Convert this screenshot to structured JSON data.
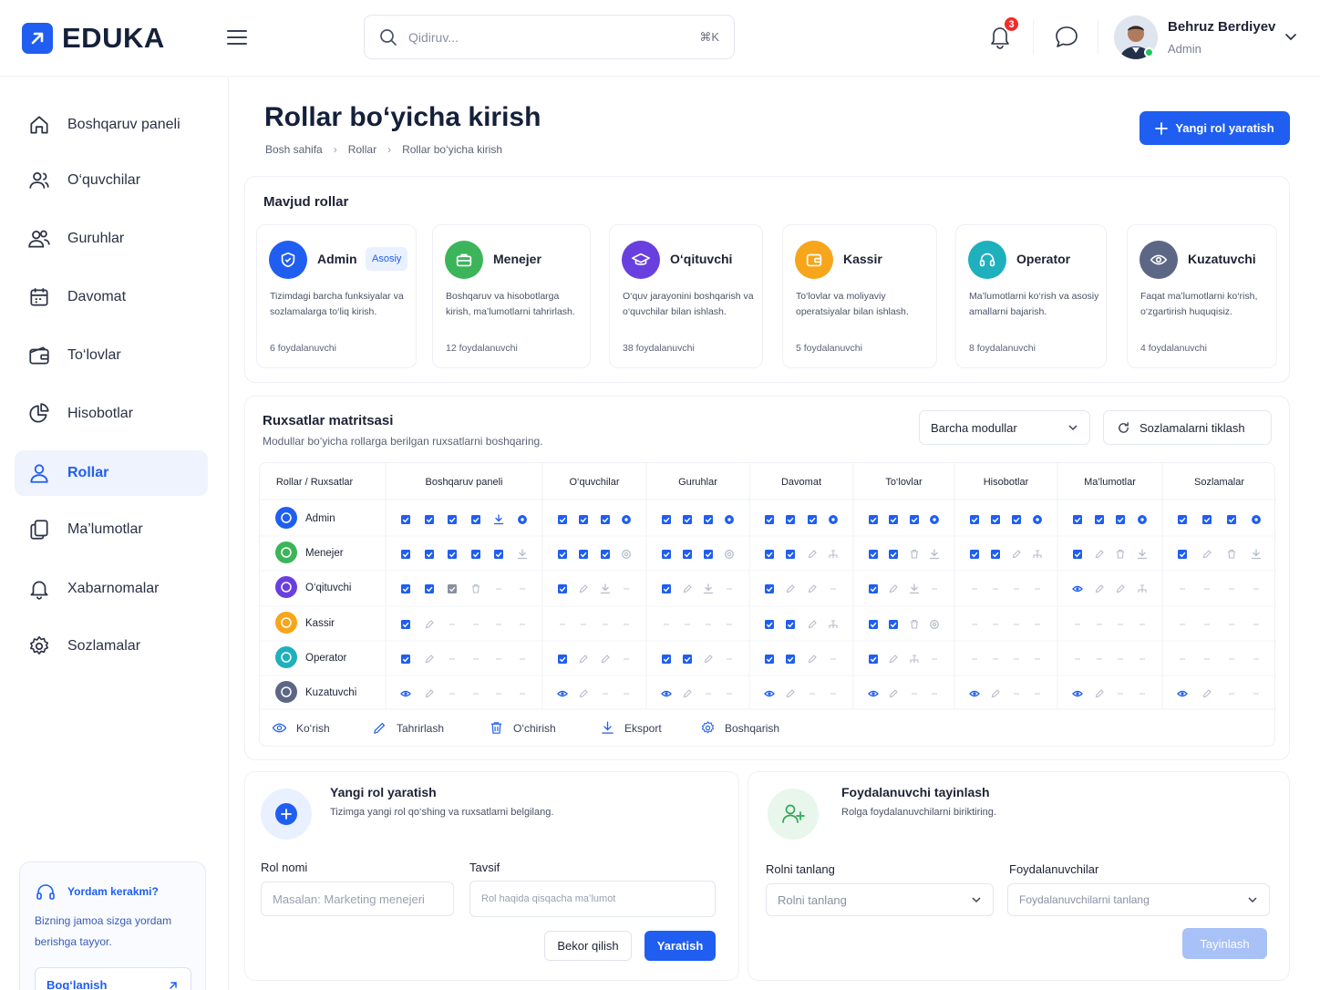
{
  "brand": {
    "name": "EDUKA",
    "color": "#1f5ef0"
  },
  "search": {
    "placeholder": "Qidiruv...",
    "shortcut": "⌘K"
  },
  "notifications": {
    "count": "3"
  },
  "user": {
    "name": "Behruz Berdiyev",
    "role": "Admin"
  },
  "sidebar": {
    "items": [
      {
        "label": "Boshqaruv paneli",
        "icon": "home-icon"
      },
      {
        "label": "O‘quvchilar",
        "icon": "users-icon"
      },
      {
        "label": "Guruhlar",
        "icon": "group-icon"
      },
      {
        "label": "Davomat",
        "icon": "calendar-icon"
      },
      {
        "label": "To‘lovlar",
        "icon": "wallet-icon"
      },
      {
        "label": "Hisobotlar",
        "icon": "pie-chart-icon"
      },
      {
        "label": "Rollar",
        "icon": "user-icon",
        "active": true
      },
      {
        "label": "Ma’lumotlar",
        "icon": "documents-icon"
      },
      {
        "label": "Xabarnomalar",
        "icon": "bell-icon"
      },
      {
        "label": "Sozlamalar",
        "icon": "gear-icon"
      }
    ],
    "help": {
      "title": "Yordam kerakmi?",
      "text": "Bizning jamoa sizga yordam berishga tayyor.",
      "button": "Bog‘lanish"
    }
  },
  "page": {
    "title": "Rollar bo‘yicha kirish",
    "breadcrumb": [
      "Bosh sahifa",
      "Rollar",
      "Rollar bo‘yicha kirish"
    ],
    "new_role_button": "Yangi rol yaratish"
  },
  "roles_section": {
    "title": "Mavjud rollar",
    "roles": [
      {
        "name": "Admin",
        "tag": "Asosiy",
        "desc": "Tizimdagi barcha funksiyalar va sozlamalarga to‘liq kirish.",
        "users": "6 foydalanuvchi",
        "color": "#1f5ef0",
        "icon": "shield-icon"
      },
      {
        "name": "Menejer",
        "tag": "",
        "desc": "Boshqaruv va hisobotlarga kirish, ma’lumotlarni tahrirlash.",
        "users": "12 foydalanuvchi",
        "color": "#3cb55a",
        "icon": "briefcase-icon"
      },
      {
        "name": "O‘qituvchi",
        "tag": "",
        "desc": "O‘quv jarayonini boshqarish va o‘quvchilar bilan ishlash.",
        "users": "38 foydalanuvchi",
        "color": "#6a3fe0",
        "icon": "graduation-cap-icon"
      },
      {
        "name": "Kassir",
        "tag": "",
        "desc": "To‘lovlar va moliyaviy operatsiyalar bilan ishlash.",
        "users": "5 foydalanuvchi",
        "color": "#f7a51a",
        "icon": "wallet-icon"
      },
      {
        "name": "Operator",
        "tag": "",
        "desc": "Ma’lumotlarni ko‘rish va asosiy amallarni bajarish.",
        "users": "8 foydalanuvchi",
        "color": "#1fb0bd",
        "icon": "headset-icon"
      },
      {
        "name": "Kuzatuvchi",
        "tag": "",
        "desc": "Faqat ma’lumotlarni ko‘rish, o‘zgartirish huquqisiz.",
        "users": "4 foydalanuvchi",
        "color": "#5c6785",
        "icon": "eye-icon"
      }
    ]
  },
  "matrix": {
    "title": "Ruxsatlar matritsasi",
    "subtitle": "Modullar bo‘yicha rollarga berilgan ruxsatlarni boshqaring.",
    "module_filter": "Barcha modullar",
    "reset_button": "Sozlamalarni tiklash",
    "corner_header": "Rollar / Ruxsatlar",
    "modules": [
      "Boshqaruv paneli",
      "O‘quvchilar",
      "Guruhlar",
      "Davomat",
      "To‘lovlar",
      "Hisobotlar",
      "Ma’lumotlar",
      "Sozlamalar"
    ],
    "legend": [
      {
        "label": "Ko‘rish",
        "icon": "eye-icon"
      },
      {
        "label": "Tahrirlash",
        "icon": "pencil-icon"
      },
      {
        "label": "O‘chirish",
        "icon": "trash-icon"
      },
      {
        "label": "Eksport",
        "icon": "download-icon"
      },
      {
        "label": "Boshqarish",
        "icon": "gear-icon"
      }
    ],
    "rows": [
      {
        "role": "Admin",
        "color": "#1f5ef0",
        "cells": [
          "CCCCDG",
          "CCCG",
          "CCCG",
          "CCCG",
          "CCCG",
          "CCCG",
          "CCCG",
          "CCCG"
        ]
      },
      {
        "role": "Menejer",
        "color": "#3cb55a",
        "cells": [
          "CCCCCd",
          "CCCg",
          "CCCg",
          "CCpx",
          "CCtd",
          "CCpx",
          "Cptd",
          "Cptd"
        ]
      },
      {
        "role": "O‘qituvchi",
        "color": "#6a3fe0",
        "cells": [
          "CCvt--",
          "Cpd-",
          "Cpd-",
          "Cpp-",
          "Cpd-",
          "----",
          "eppx",
          "----"
        ]
      },
      {
        "role": "Kassir",
        "color": "#f7a51a",
        "cells": [
          "Cp----",
          "----",
          "----",
          "CCpx",
          "CCtg",
          "----",
          "----",
          "----"
        ]
      },
      {
        "role": "Operator",
        "color": "#1fb0bd",
        "cells": [
          "Cp----",
          "Cpp-",
          "CCp-",
          "CCp-",
          "Cpx-",
          "----",
          "----",
          "----"
        ]
      },
      {
        "role": "Kuzatuvchi",
        "color": "#5c6785",
        "cells": [
          "ep----",
          "ep--",
          "ep--",
          "ep--",
          "ep--",
          "ep--",
          "ep--",
          "ep--"
        ]
      }
    ]
  },
  "create_role": {
    "title": "Yangi rol yaratish",
    "subtitle": "Tizimga yangi rol qo‘shing va ruxsatlarni belgilang.",
    "name_label": "Rol nomi",
    "name_placeholder": "Masalan: Marketing menejeri",
    "desc_label": "Tavsif",
    "desc_placeholder": "Rol haqida qisqacha ma’lumot",
    "cancel": "Bekor qilish",
    "submit": "Yaratish"
  },
  "assign_user": {
    "title": "Foydalanuvchi tayinlash",
    "subtitle": "Rolga foydalanuvchilarni biriktiring.",
    "role_label": "Rolni tanlang",
    "role_placeholder": "Rolni tanlang",
    "users_label": "Foydalanuvchilar",
    "users_placeholder": "Foydalanuvchilarni tanlang",
    "submit": "Tayinlash"
  }
}
